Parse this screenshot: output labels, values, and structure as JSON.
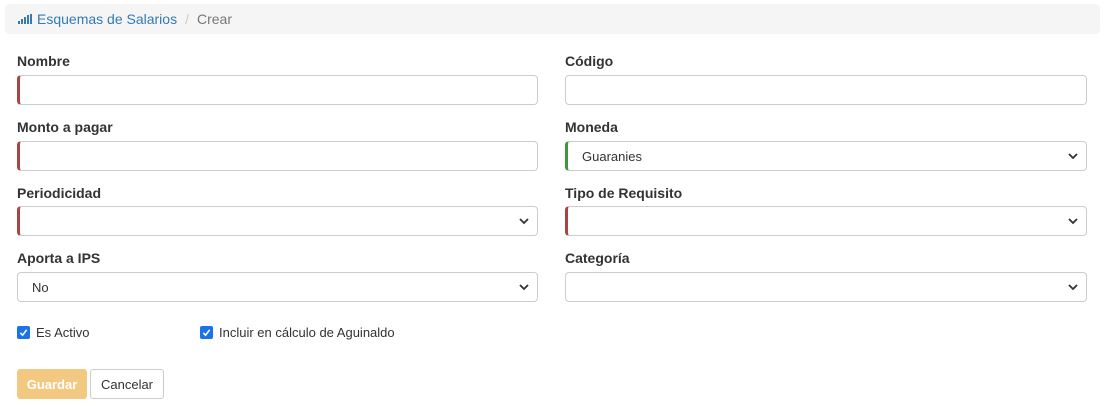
{
  "breadcrumb": {
    "icon": "signal-bars-icon",
    "link_label": "Esquemas de Salarios",
    "current_label": "Crear",
    "link_color": "#337ab7"
  },
  "form": {
    "nombre": {
      "label": "Nombre",
      "value": ""
    },
    "codigo": {
      "label": "Código",
      "value": ""
    },
    "monto": {
      "label": "Monto a pagar",
      "value": ""
    },
    "moneda": {
      "label": "Moneda",
      "selected": "Guaranies"
    },
    "periodicidad": {
      "label": "Periodicidad",
      "selected": ""
    },
    "tipo_requisito": {
      "label": "Tipo de Requisito",
      "selected": ""
    },
    "aporta_ips": {
      "label": "Aporta a IPS",
      "selected": "No"
    },
    "categoria": {
      "label": "Categoría",
      "selected": ""
    },
    "es_activo": {
      "label": "Es Activo",
      "checked": true
    },
    "aguinaldo": {
      "label": "Incluir en cálculo de Aguinaldo",
      "checked": true
    }
  },
  "buttons": {
    "save_label": "Guardar",
    "cancel_label": "Cancelar"
  },
  "colors": {
    "required_indicator": "#a94442",
    "valid_indicator": "#3c9a3c",
    "save_button": "#f3c982",
    "checkbox": "#1a73e8"
  }
}
